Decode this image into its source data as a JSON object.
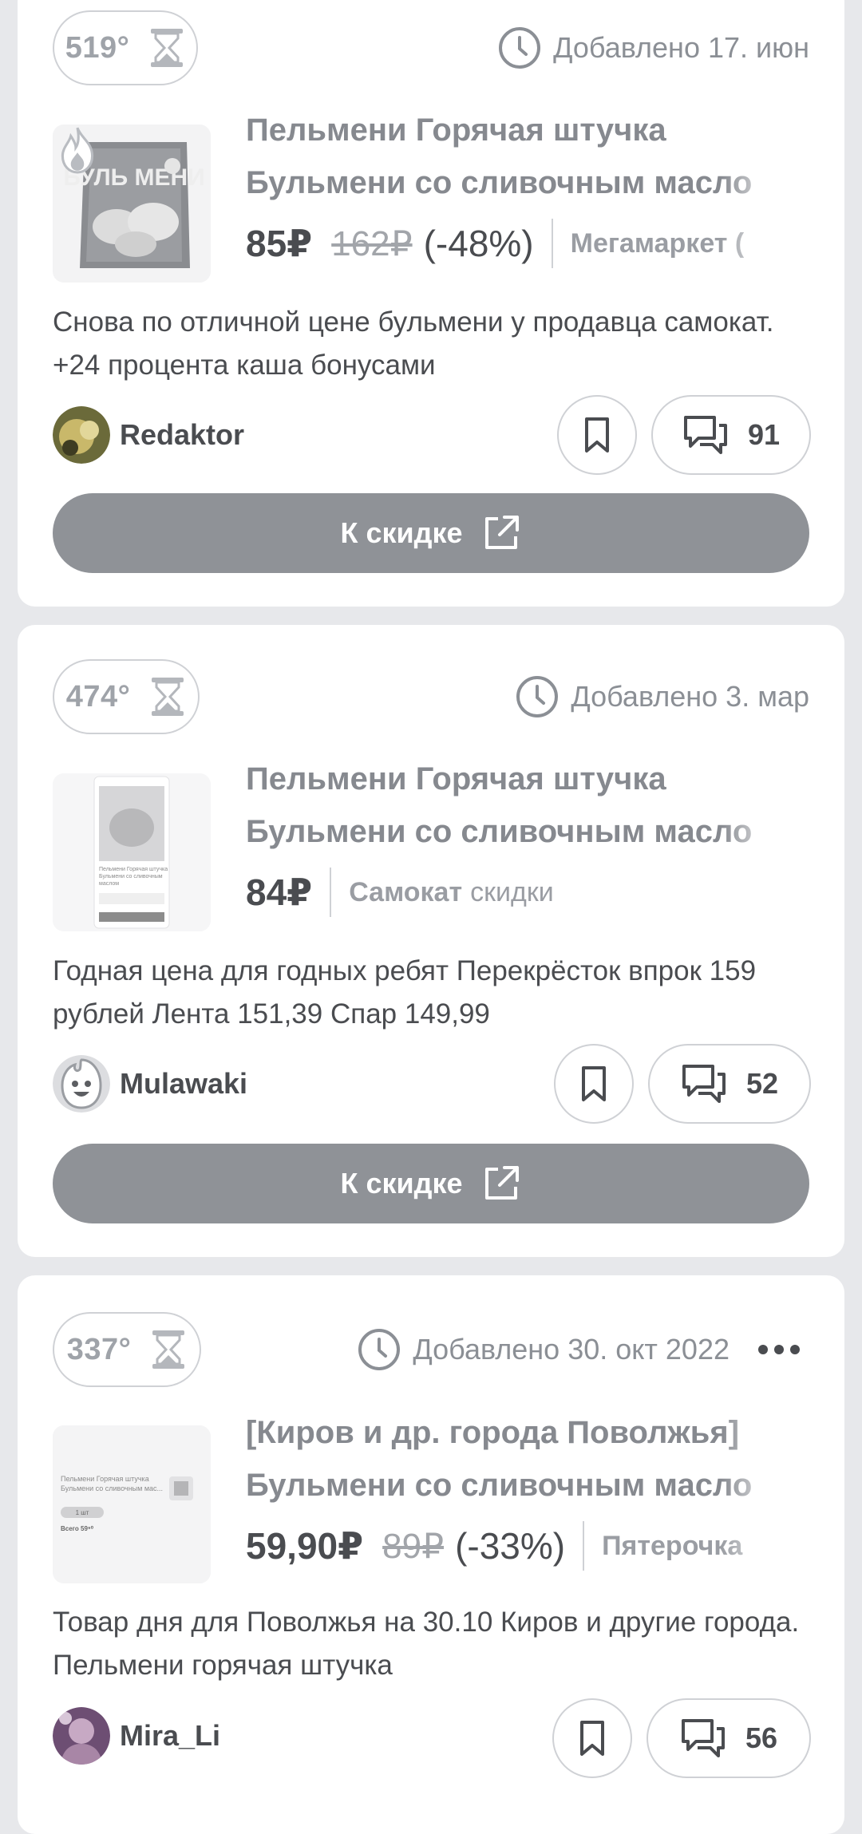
{
  "deals": [
    {
      "temperature": "519°",
      "added": "Добавлено 17. июн",
      "title_line1": "Пельмени Горячая штучка",
      "title_line2": "Бульмени со сливочным масло",
      "price": "85₽",
      "old_price": "162₽",
      "discount": "(-48%)",
      "shop": "Мегамаркет (",
      "shop_sub": "",
      "description": "Снова по отличной цене бульмени у продавца самокат. +24 процента каша бонусами",
      "username": "Redaktor",
      "comments": "91",
      "button_label": "К скидке",
      "hot": true
    },
    {
      "temperature": "474°",
      "added": "Добавлено 3. мар",
      "title_line1": "Пельмени Горячая штучка",
      "title_line2": "Бульмени со сливочным масло",
      "price": "84₽",
      "old_price": "",
      "discount": "",
      "shop": "Самокат",
      "shop_sub": "скидки",
      "description": "Годная цена для годных ребят Перекрёсток впрок 159 рублей Лента 151,39 Спар 149,99",
      "username": "Mulawaki",
      "comments": "52",
      "button_label": "К скидке",
      "hot": false
    },
    {
      "temperature": "337°",
      "added": "Добавлено 30. окт 2022",
      "title_line1": "[Киров и др. города Поволжья]",
      "title_line2": "Бульмени со сливочным масло",
      "price": "59,90₽",
      "old_price": "89₽",
      "discount": "(-33%)",
      "shop": "Пятерочка",
      "shop_sub": "",
      "description": "Товар дня для Поволжья на 30.10 Киров и другие города. Пельмени горячая штучка",
      "username": "Mira_Li",
      "comments": "56",
      "button_label": "",
      "hot": false
    }
  ],
  "thumb_text": {
    "bag_brand": "БУЛЬ МЕНИ",
    "screen2_line1": "Пельмени Горячая штучка",
    "screen2_line2": "Бульмени со сливочным",
    "screen2_line3": "маслом",
    "screen3_line1": "Пельмени Горячая штучка",
    "screen3_line2": "Бульмени со сливочным мас...",
    "screen3_qty": "1 шт",
    "screen3_total": "Всего 59⁹⁰"
  },
  "icons": {
    "temperature": "hourglass-icon",
    "added": "clock-icon",
    "hot": "flame-icon",
    "bookmark": "bookmark-icon",
    "comments": "comments-icon",
    "external": "external-link-icon",
    "menu": "more-dots-icon"
  },
  "colors": {
    "page_bg": "#e7e8eb",
    "card_bg": "#ffffff",
    "button_bg": "#8f9297",
    "text": "#4a4c50",
    "muted": "#86898f"
  }
}
